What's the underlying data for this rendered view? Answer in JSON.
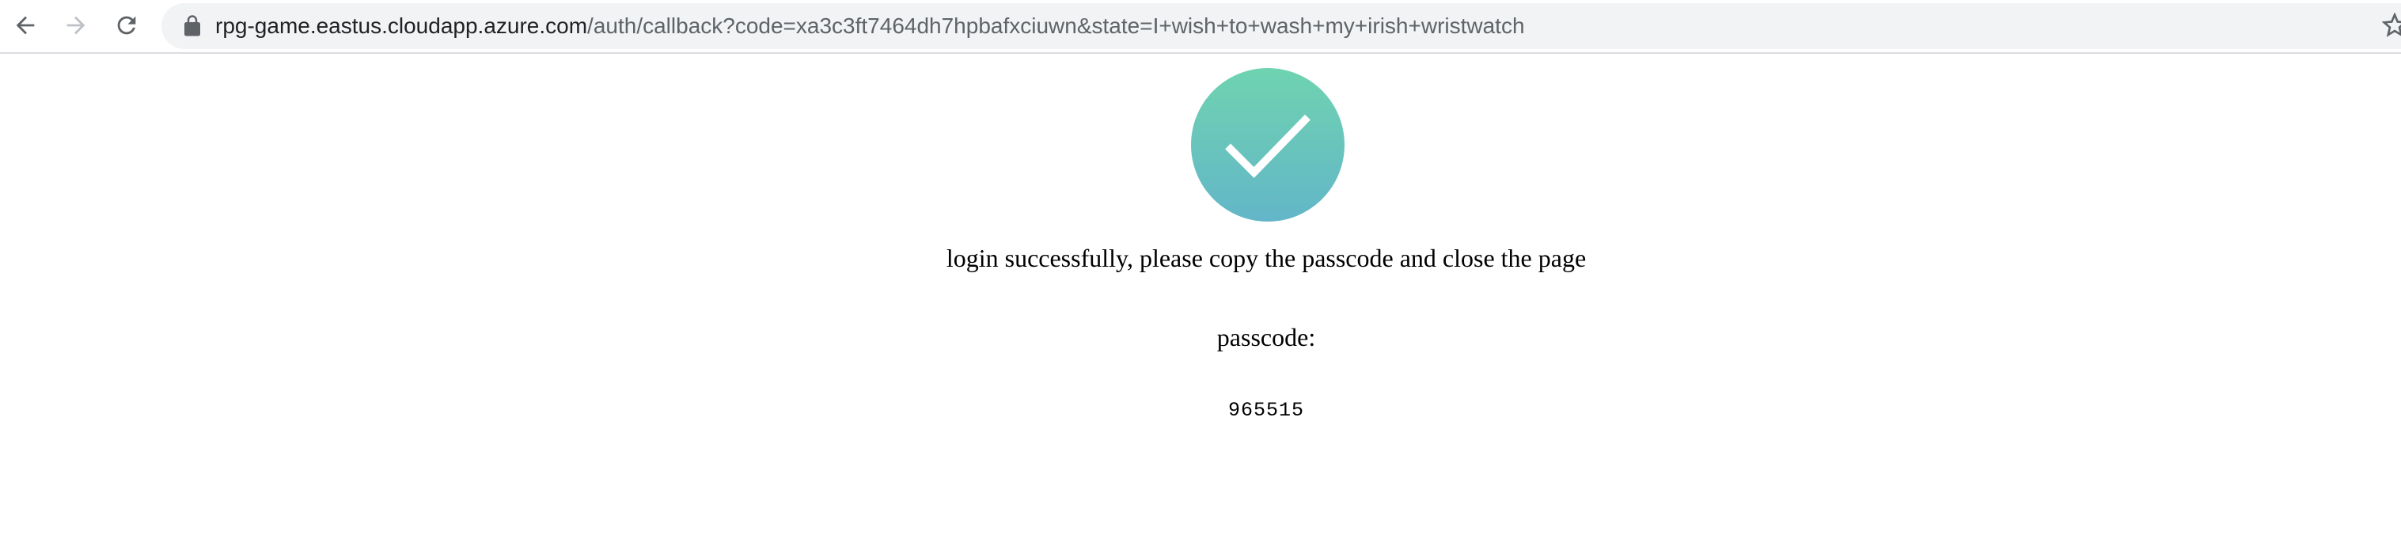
{
  "browser": {
    "url_host": "rpg-game.eastus.cloudapp.azure.com",
    "url_path": "/auth/callback?code=xa3c3ft7464dh7hpbafxciuwn&state=I+wish+to+wash+my+irish+wristwatch",
    "icons": [
      "back-arrow-icon",
      "forward-arrow-icon",
      "reload-icon",
      "lock-icon",
      "star-icon"
    ]
  },
  "page": {
    "status_icon": "checkmark-circle-icon",
    "success_message": "login successfully, please copy the passcode and close the page",
    "passcode_label": "passcode:",
    "passcode_value": "965515",
    "colors": {
      "check_gradient_top": "#6fd3b0",
      "check_gradient_bottom": "#63b6c8"
    }
  }
}
